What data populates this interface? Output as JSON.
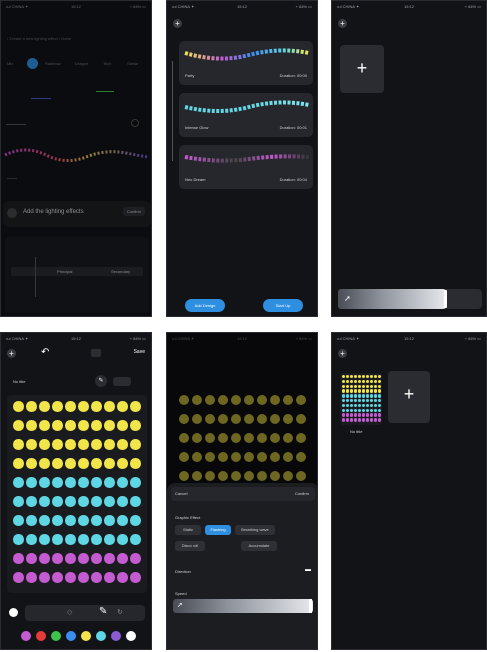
{
  "status": {
    "carrier": "•ul CHINA ✦",
    "time": "15:12",
    "battery": "⌁ 84% ▭"
  },
  "screen1": {
    "tabs": [
      "Mix",
      "",
      "Rainbow",
      "Dragon",
      "Tech",
      "Stellar"
    ],
    "header_text": "‹  Create a new lighting effect  ›  Done",
    "effects_title": "Add the lighting effects",
    "effects_btn": "Confirm",
    "row_a": "Principal",
    "row_b": "Secondary"
  },
  "screen2": {
    "presets": [
      {
        "name": "Party",
        "duration": "Duration: 00:00"
      },
      {
        "name": "Intense Glow",
        "duration": "Duration: 00:01"
      },
      {
        "name": "Neo Dream",
        "duration": "Duration: 00:04"
      }
    ],
    "add_btn": "Add Design",
    "play_btn": "Start Up"
  },
  "screen3": {
    "add_symbol": "+"
  },
  "screen4": {
    "title": "No title",
    "save": "Save",
    "rows": [
      "#f2e54a",
      "#f2e54a",
      "#f2e54a",
      "#f2e54a",
      "#5fd6e3",
      "#5fd6e3",
      "#5fd6e3",
      "#5fd6e3",
      "#c45bd1",
      "#c45bd1"
    ],
    "palette": [
      "#c45bd1",
      "#e53b3b",
      "#3fc24a",
      "#3a8ef0",
      "#f2e54a",
      "#5fd6e3",
      "#8a5bd1",
      "#ffffff"
    ]
  },
  "screen5": {
    "cancel": "Cancel",
    "confirm": "Confirm",
    "section_title": "Graphic Effect",
    "options": [
      "Static",
      "Flashing",
      "Breathing wave",
      "Disco roll",
      "Accumulate"
    ],
    "direction_label": "Direction",
    "speed_label": "Speed"
  },
  "screen6": {
    "design_label": "No title",
    "add_symbol": "+"
  }
}
